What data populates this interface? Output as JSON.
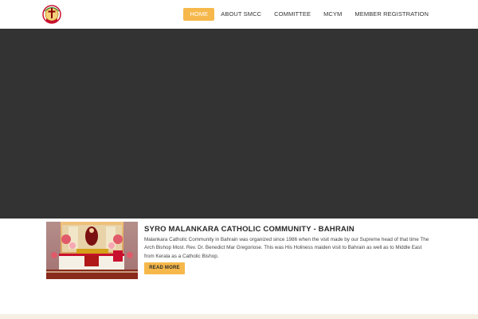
{
  "nav": {
    "items": [
      "HOME",
      "ABOUT SMCC",
      "COMMITTEE",
      "MCYM",
      "MEMBER REGISTRATION"
    ],
    "active_index": 0
  },
  "logo": {
    "icon": "church-crest-logo"
  },
  "post": {
    "title": "SYRO MALANKARA CATHOLIC COMMUNITY - BAHRAIN",
    "text": "Malankara Catholic Community in Bahrain was organized since 1986 when the visit made by our Supreme head of that time The Arch Bishop Most. Rev. Dr. Benedict Mar Gregoriose. This was His Holiness maiden visit to Bahrain as well as to Middle East from Kerala as a Catholic Bishop.",
    "button_label": "READ MORE",
    "image": "church-altar-photo"
  },
  "colors": {
    "accent": "#f6b84b",
    "hero": "#333333",
    "footer": "#f5efe4"
  }
}
